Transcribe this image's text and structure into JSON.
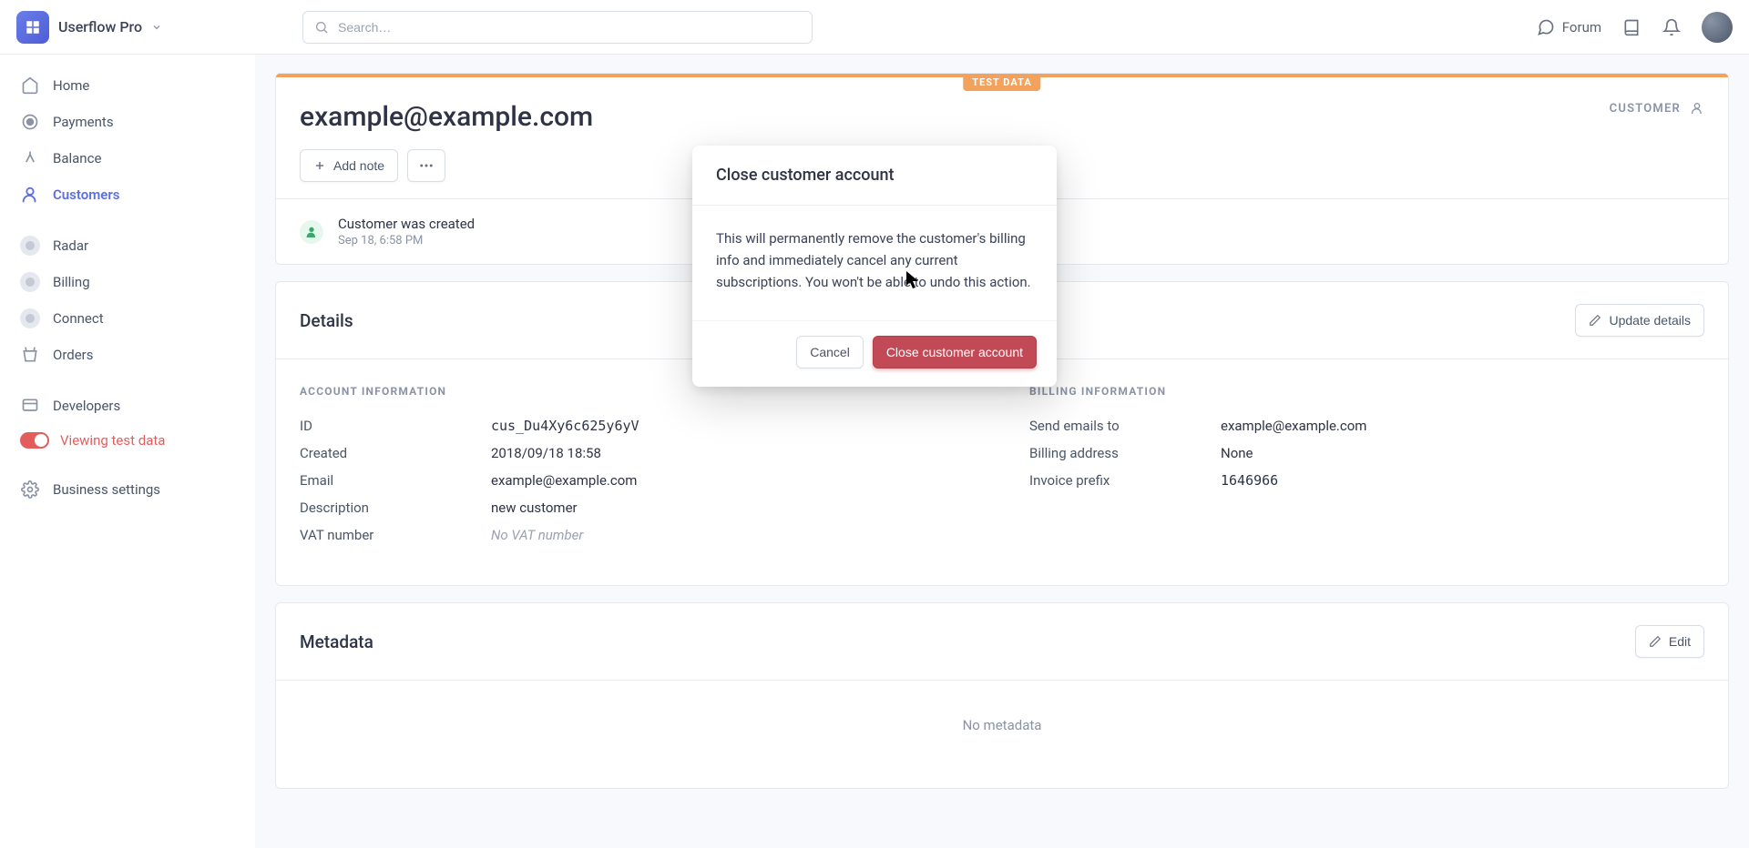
{
  "brand": {
    "name": "Userflow Pro"
  },
  "search": {
    "placeholder": "Search…"
  },
  "topnav": {
    "forum": "Forum"
  },
  "sidebar": {
    "items": [
      {
        "label": "Home"
      },
      {
        "label": "Payments"
      },
      {
        "label": "Balance"
      },
      {
        "label": "Customers"
      },
      {
        "label": "Radar"
      },
      {
        "label": "Billing"
      },
      {
        "label": "Connect"
      },
      {
        "label": "Orders"
      },
      {
        "label": "Developers"
      }
    ],
    "test_mode_label": "Viewing test data",
    "business_settings": "Business settings"
  },
  "customer": {
    "test_data_badge": "TEST DATA",
    "email": "example@example.com",
    "type_label": "CUSTOMER",
    "add_note": "Add note",
    "event": {
      "title": "Customer was created",
      "time": "Sep 18, 6:58 PM"
    }
  },
  "details": {
    "title": "Details",
    "update_button": "Update details",
    "account": {
      "heading": "ACCOUNT INFORMATION",
      "rows": {
        "id_label": "ID",
        "id_value": "cus_Du4Xy6c625y6yV",
        "created_label": "Created",
        "created_value": "2018/09/18 18:58",
        "email_label": "Email",
        "email_value": "example@example.com",
        "desc_label": "Description",
        "desc_value": "new customer",
        "vat_label": "VAT number",
        "vat_value": "No VAT number"
      }
    },
    "billing": {
      "heading": "BILLING INFORMATION",
      "rows": {
        "send_label": "Send emails to",
        "send_value": "example@example.com",
        "addr_label": "Billing address",
        "addr_value": "None",
        "prefix_label": "Invoice prefix",
        "prefix_value": "1646966"
      }
    }
  },
  "metadata": {
    "title": "Metadata",
    "edit_button": "Edit",
    "empty": "No metadata"
  },
  "modal": {
    "title": "Close customer account",
    "body": "This will permanently remove the customer's billing info and immediately cancel any current subscriptions. You won't be able to undo this action.",
    "cancel": "Cancel",
    "confirm": "Close customer account"
  }
}
